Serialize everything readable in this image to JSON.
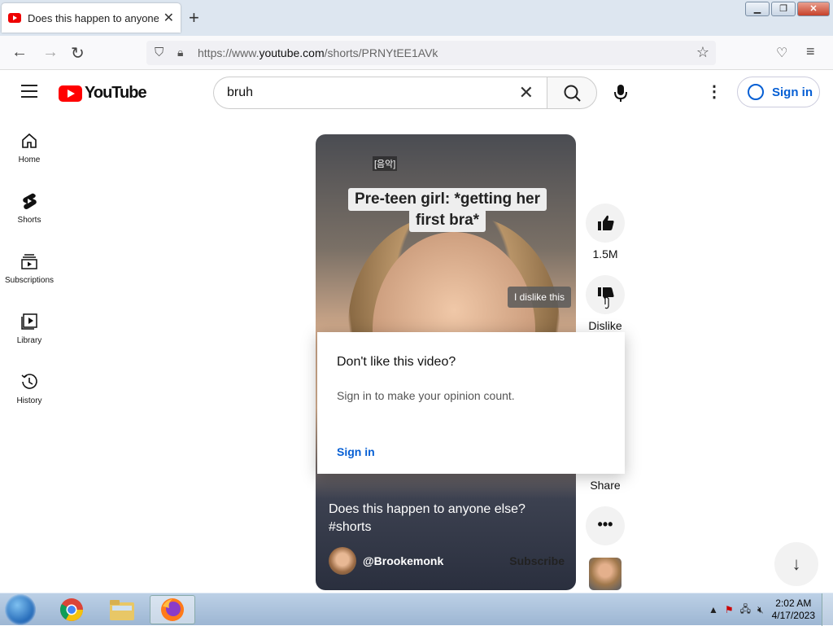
{
  "browser": {
    "tab_title": "Does this happen to anyone else?",
    "url_prefix": "https://www.",
    "url_domain": "youtube.com",
    "url_path": "/shorts/PRNYtEE1AVk"
  },
  "youtube": {
    "logo_text": "YouTube",
    "search_value": "bruh",
    "sign_in": "Sign in"
  },
  "sidebar": {
    "items": [
      {
        "label": "Home"
      },
      {
        "label": "Shorts"
      },
      {
        "label": "Subscriptions"
      },
      {
        "label": "Library"
      },
      {
        "label": "History"
      }
    ]
  },
  "video": {
    "audio_tag": "[음악]",
    "caption_line1": "Pre-teen girl: *getting her",
    "caption_line2": "first bra*",
    "tooltip": "I dislike this",
    "title": "Does this happen to anyone else?",
    "hashtag": "#shorts",
    "channel": "@Brookemonk",
    "subscribe": "Subscribe"
  },
  "actions": {
    "like_count": "1.5M",
    "dislike_label": "Dislike",
    "share_label": "Share"
  },
  "popup": {
    "title": "Don't like this video?",
    "text": "Sign in to make your opinion count.",
    "sign_in": "Sign in"
  },
  "taskbar": {
    "time": "2:02 AM",
    "date": "4/17/2023"
  },
  "colors": {
    "yt_red": "#ff0000",
    "link_blue": "#065fd4"
  }
}
